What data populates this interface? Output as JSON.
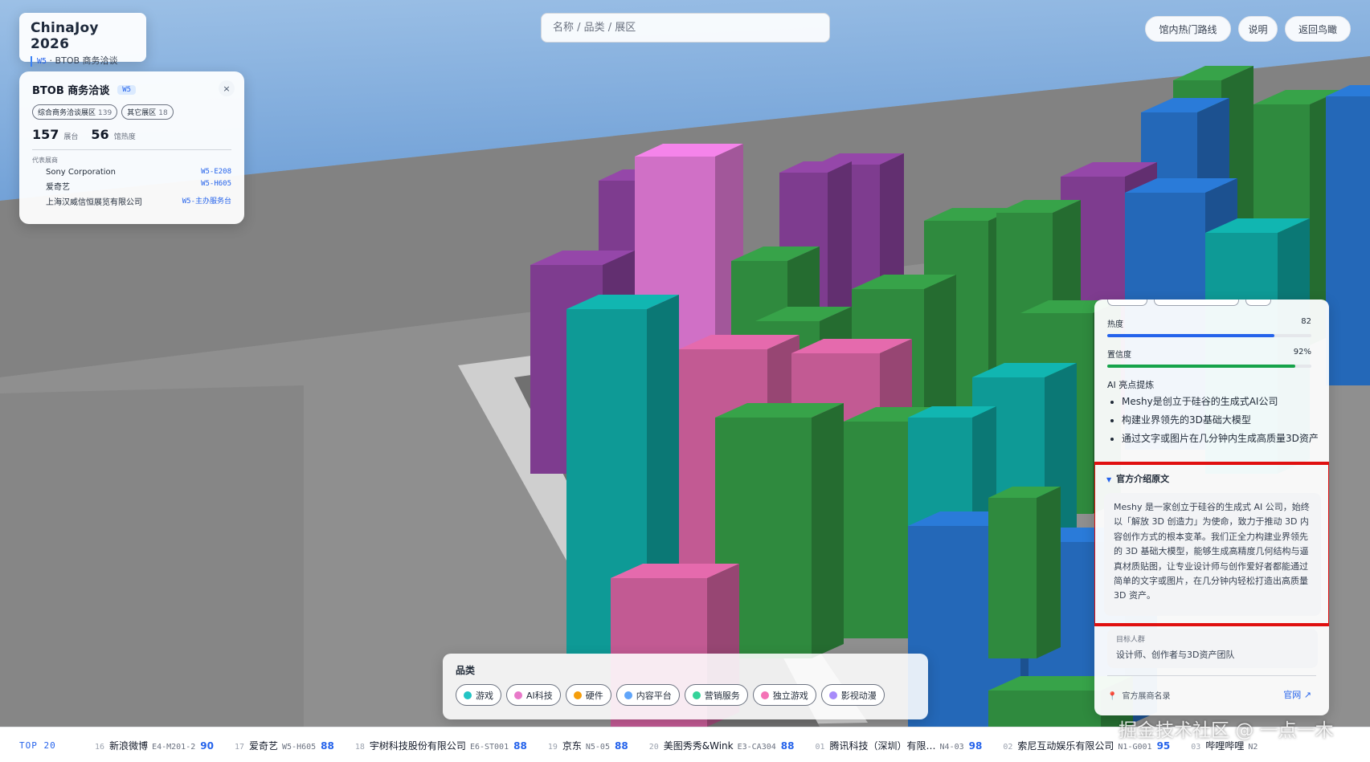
{
  "brand": {
    "title": "ChinaJoy 2026",
    "hall_code": "W5",
    "separator": "·",
    "hall_name": "BTOB 商务洽谈"
  },
  "search": {
    "placeholder": "名称 / 品类 / 展区"
  },
  "top_buttons": {
    "hot_routes": "馆内热门路线",
    "help": "说明",
    "back": "返回鸟瞰"
  },
  "zone_panel": {
    "title": "BTOB 商务洽谈",
    "tag": "W5",
    "close": "×",
    "chips": [
      {
        "label": "综合商务洽谈展区",
        "count": "139"
      },
      {
        "label": "其它展区",
        "count": "18"
      }
    ],
    "stats": {
      "booths": "157",
      "booths_unit": "展台",
      "heat": "56",
      "heat_unit": "馆热度"
    },
    "reps_label": "代表展商",
    "reps": [
      {
        "name": "Sony Corporation",
        "code": "W5-E208"
      },
      {
        "name": "爱奇艺",
        "code": "W5-H605"
      },
      {
        "name": "上海汉威信恒展览有限公司",
        "code": "W5-主办服务台"
      }
    ]
  },
  "detail": {
    "heat_label": "热度",
    "heat_value": "82",
    "heat_level": 0.82,
    "confidence_label": "置信度",
    "confidence_value": "92%",
    "confidence_level": 0.92,
    "ai_label": "AI 亮点提炼",
    "highlights": [
      "Meshy是创立于硅谷的生成式AI公司",
      "构建业界领先的3D基础大模型",
      "通过文字或图片在几分钟内生成高质量3D资产"
    ],
    "official_label": "官方介绍原文",
    "official_arrow": "▼",
    "official_text": "Meshy 是一家创立于硅谷的生成式 AI 公司，始终以「解放 3D 创造力」为使命，致力于推动 3D 内容创作方式的根本变革。我们正全力构建业界领先的 3D 基础大模型，能够生成高精度几何结构与逼真材质贴图，让专业设计师与创作爱好者都能通过简单的文字或图片，在几分钟内轻松打造出高质量 3D 资产。",
    "audience_label": "目标人群",
    "audience_value": "设计师、创作者与3D资产团队",
    "footer_label": "官方展商名录",
    "footer_link": "官网 ↗",
    "pin_icon": "📍",
    "colors": {
      "heat": "#2563eb",
      "confidence": "#16a34a",
      "highlight_border": "#e01010"
    }
  },
  "categories": {
    "label": "品类",
    "items": [
      {
        "label": "游戏",
        "color": "#22c4c4"
      },
      {
        "label": "AI科技",
        "color": "#e879c9"
      },
      {
        "label": "硬件",
        "color": "#f59e0b"
      },
      {
        "label": "内容平台",
        "color": "#60a5fa"
      },
      {
        "label": "营销服务",
        "color": "#34d399"
      },
      {
        "label": "独立游戏",
        "color": "#f472b6"
      },
      {
        "label": "影视动漫",
        "color": "#a78bfa"
      }
    ]
  },
  "ticker": {
    "title": "TOP 20",
    "items": [
      {
        "rank": "16",
        "name": "新浪微博",
        "code": "E4-M201-2",
        "score": "90"
      },
      {
        "rank": "17",
        "name": "爱奇艺",
        "code": "W5-H605",
        "score": "88"
      },
      {
        "rank": "18",
        "name": "宇树科技股份有限公司",
        "code": "E6-ST001",
        "score": "88"
      },
      {
        "rank": "19",
        "name": "京东",
        "code": "N5-05",
        "score": "88"
      },
      {
        "rank": "20",
        "name": "美图秀秀&Wink",
        "code": "E3-CA304",
        "score": "88"
      },
      {
        "rank": "01",
        "name": "腾讯科技（深圳）有限…",
        "code": "N4-03",
        "score": "98"
      },
      {
        "rank": "02",
        "name": "索尼互动娱乐有限公司",
        "code": "N1-G001",
        "score": "95"
      },
      {
        "rank": "03",
        "name": "哔哩哔哩",
        "code": "N2",
        "score": ""
      }
    ]
  },
  "watermark": "掘金技术社区 @ 一点一木",
  "scene_colors": {
    "sky": "#87b4e0",
    "floor": "#8e8e8e",
    "wall": "#7f7f7f",
    "pink": "#c25a93",
    "purple": "#7e3c8f",
    "teal": "#0e9a96",
    "green": "#2f8a3e",
    "blue": "#2468b8",
    "lightpink": "#d070c6"
  }
}
